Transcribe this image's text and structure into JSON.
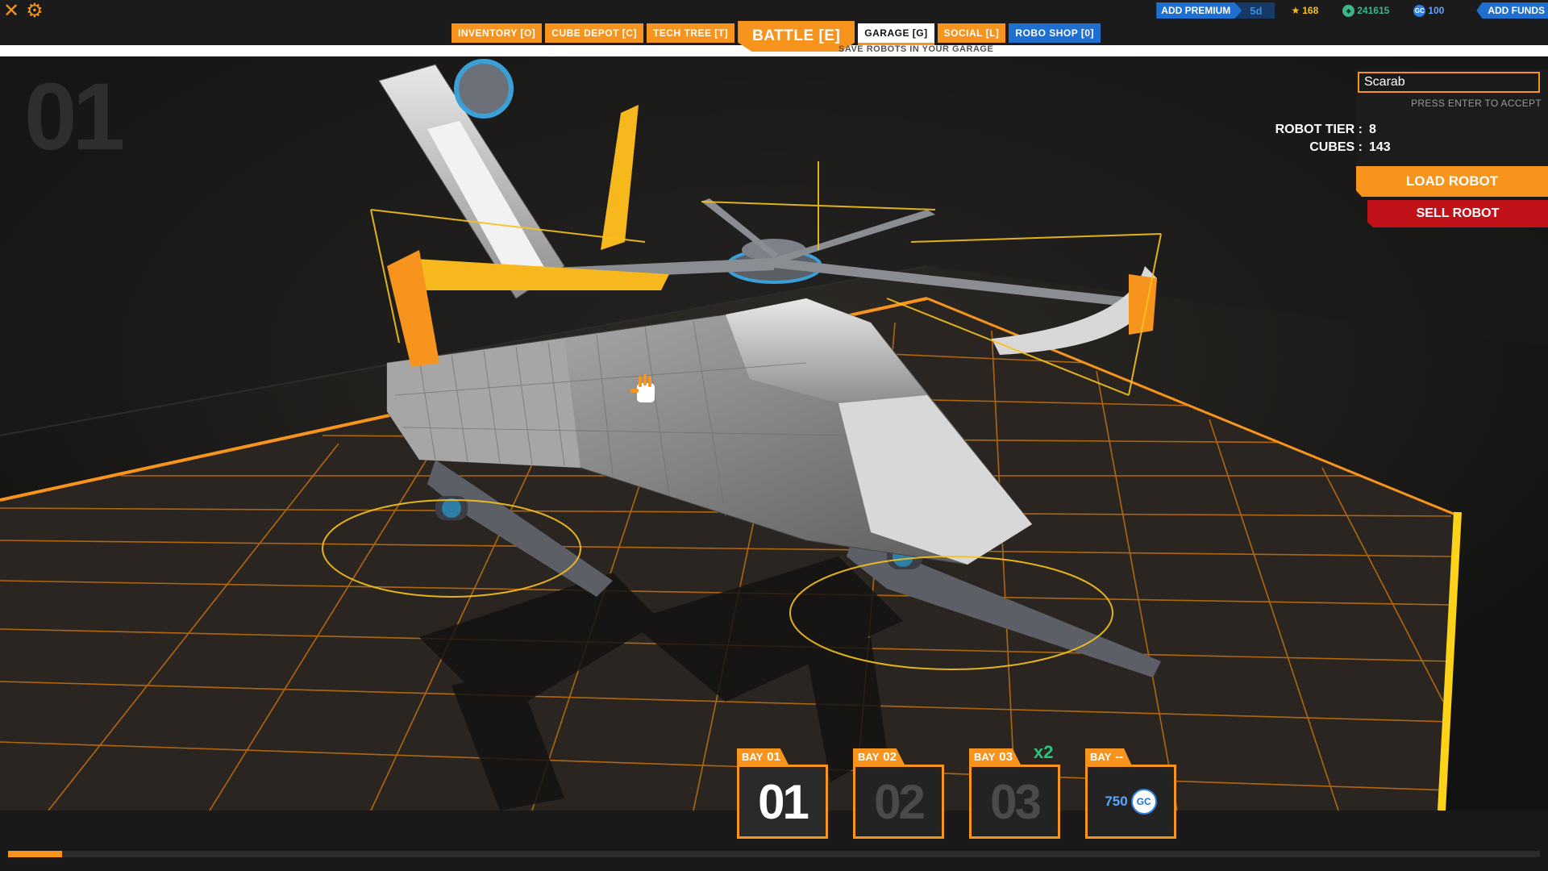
{
  "topbar": {
    "close_icon": "close-icon",
    "settings_icon": "gear-icon",
    "tabs": [
      {
        "label": "INVENTORY [O]"
      },
      {
        "label": "CUBE DEPOT [C]"
      },
      {
        "label": "TECH TREE [T]"
      },
      {
        "label": "BATTLE [E]"
      },
      {
        "label": "GARAGE [G]"
      },
      {
        "label": "SOCIAL [L]"
      },
      {
        "label": "ROBO SHOP [0]"
      }
    ],
    "active_tab_hint": "SAVE ROBOTS IN YOUR GARAGE",
    "add_premium_label": "ADD PREMIUM",
    "premium_days": "5d",
    "stars": "168",
    "credits": "241615",
    "gc_icon_text": "GC",
    "galaxy_coins": "100",
    "add_funds_label": "ADD FUNDS"
  },
  "robot": {
    "bay_watermark": "01",
    "name_value": "Scarab",
    "name_hint": "PRESS ENTER TO ACCEPT",
    "tier_label": "ROBOT TIER :",
    "tier_value": "8",
    "cubes_label": "CUBES :",
    "cubes_value": "143",
    "load_label": "LOAD ROBOT",
    "sell_label": "SELL ROBOT"
  },
  "bays": [
    {
      "label": "BAY",
      "num": "01",
      "display": "01"
    },
    {
      "label": "BAY",
      "num": "02",
      "display": "02"
    },
    {
      "label": "BAY",
      "num": "03",
      "display": "03",
      "multiplier": "x2"
    },
    {
      "label": "BAY",
      "num": "--",
      "price": "750",
      "price_icon_text": "GC"
    }
  ],
  "progress_fraction": 0.035,
  "colors": {
    "accent": "#f7941d",
    "premium": "#1e6fd0",
    "sell": "#c1121a",
    "credits": "#3fb68a",
    "multiplier": "#2ec27e"
  }
}
